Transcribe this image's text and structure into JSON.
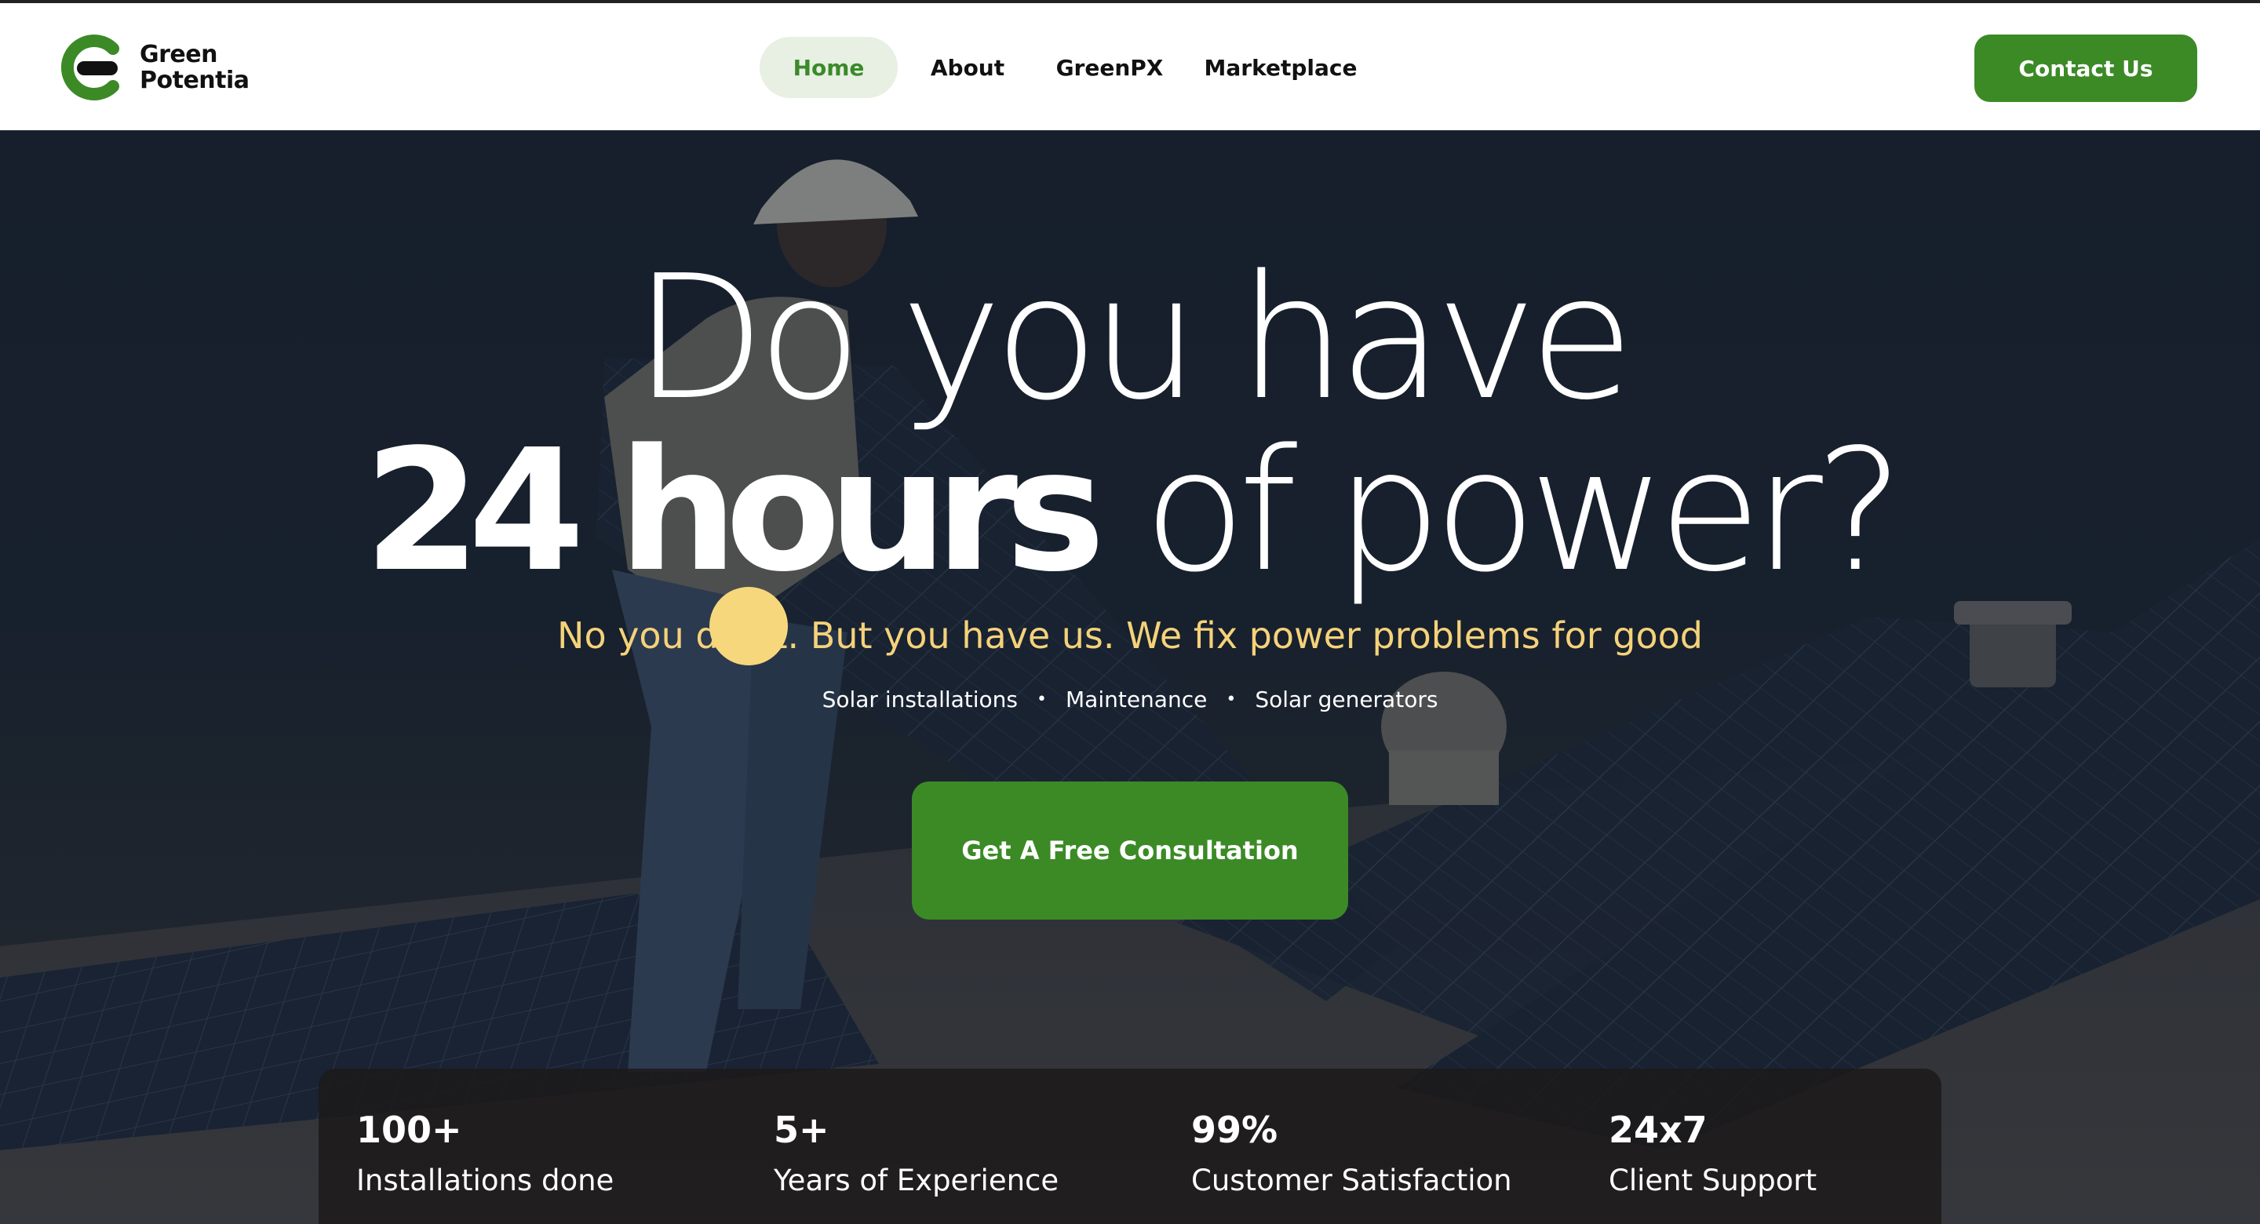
{
  "nav": {
    "logo": {
      "line1": "Green",
      "line2": "Potentia",
      "icon": "green-potentia-logo-icon"
    },
    "items": [
      {
        "label": "Home",
        "active": true
      },
      {
        "label": "About",
        "active": false
      },
      {
        "label": "GreenPX",
        "active": false
      },
      {
        "label": "Marketplace",
        "active": false
      }
    ],
    "contact_label": "Contact Us"
  },
  "hero": {
    "headline_line1": "Do you have",
    "headline_bold": "24 hours",
    "headline_light": "of power?",
    "subline": "No you don't. But you have us. We fix power problems for good",
    "services": [
      "Solar installations",
      "Maintenance",
      "Solar generators"
    ],
    "service_separator": "•",
    "cta_label": "Get A Free Consultation"
  },
  "stats": [
    {
      "value": "100+",
      "label": "Installations done"
    },
    {
      "value": "5+",
      "label": "Years of Experience"
    },
    {
      "value": "99%",
      "label": "Customer Satisfaction"
    },
    {
      "value": "24x7",
      "label": "Client Support"
    }
  ],
  "colors": {
    "brand_green": "#3b8a26",
    "active_tab_bg": "#e7f0e3",
    "subline_yellow": "#f5d27a",
    "hero_dark": "#1b2534"
  }
}
